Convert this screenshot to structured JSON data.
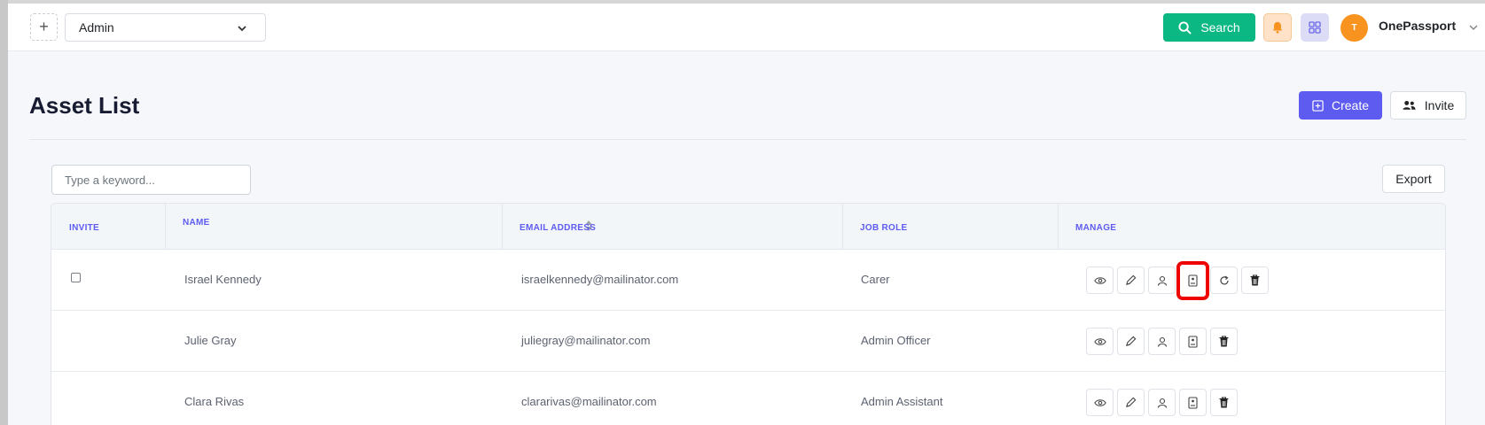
{
  "header": {
    "add_symbol": "+",
    "org_select": "Admin",
    "search_label": "Search",
    "avatar_initial": "T",
    "user_name": "OnePassport"
  },
  "page": {
    "title": "Asset List",
    "create_label": "Create",
    "invite_label": "Invite"
  },
  "toolbar": {
    "keyword_placeholder": "Type a keyword...",
    "export_label": "Export"
  },
  "table": {
    "columns": [
      "INVITE",
      "NAME",
      "EMAIL ADDRESS",
      "JOB ROLE",
      "MANAGE"
    ],
    "rows": [
      {
        "name": "Israel Kennedy",
        "email": "israelkennedy@mailinator.com",
        "role": "Carer",
        "has_checkbox": true,
        "actions": [
          "eye-icon",
          "pencil-icon",
          "user-icon",
          "badge-icon",
          "refresh-icon",
          "trash-icon"
        ]
      },
      {
        "name": "Julie Gray",
        "email": "juliegray@mailinator.com",
        "role": "Admin Officer",
        "has_checkbox": false,
        "actions": [
          "eye-icon",
          "pencil-icon",
          "user-icon",
          "badge-icon",
          "trash-icon"
        ]
      },
      {
        "name": "Clara Rivas",
        "email": "clararivas@mailinator.com",
        "role": "Admin Assistant",
        "has_checkbox": false,
        "actions": [
          "eye-icon",
          "pencil-icon",
          "user-icon",
          "badge-icon",
          "trash-icon"
        ]
      }
    ]
  },
  "colors": {
    "primary": "#5e5cf0",
    "search_green": "#0bb783",
    "avatar_orange": "#f7931e",
    "highlight_red": "#ee0000"
  }
}
